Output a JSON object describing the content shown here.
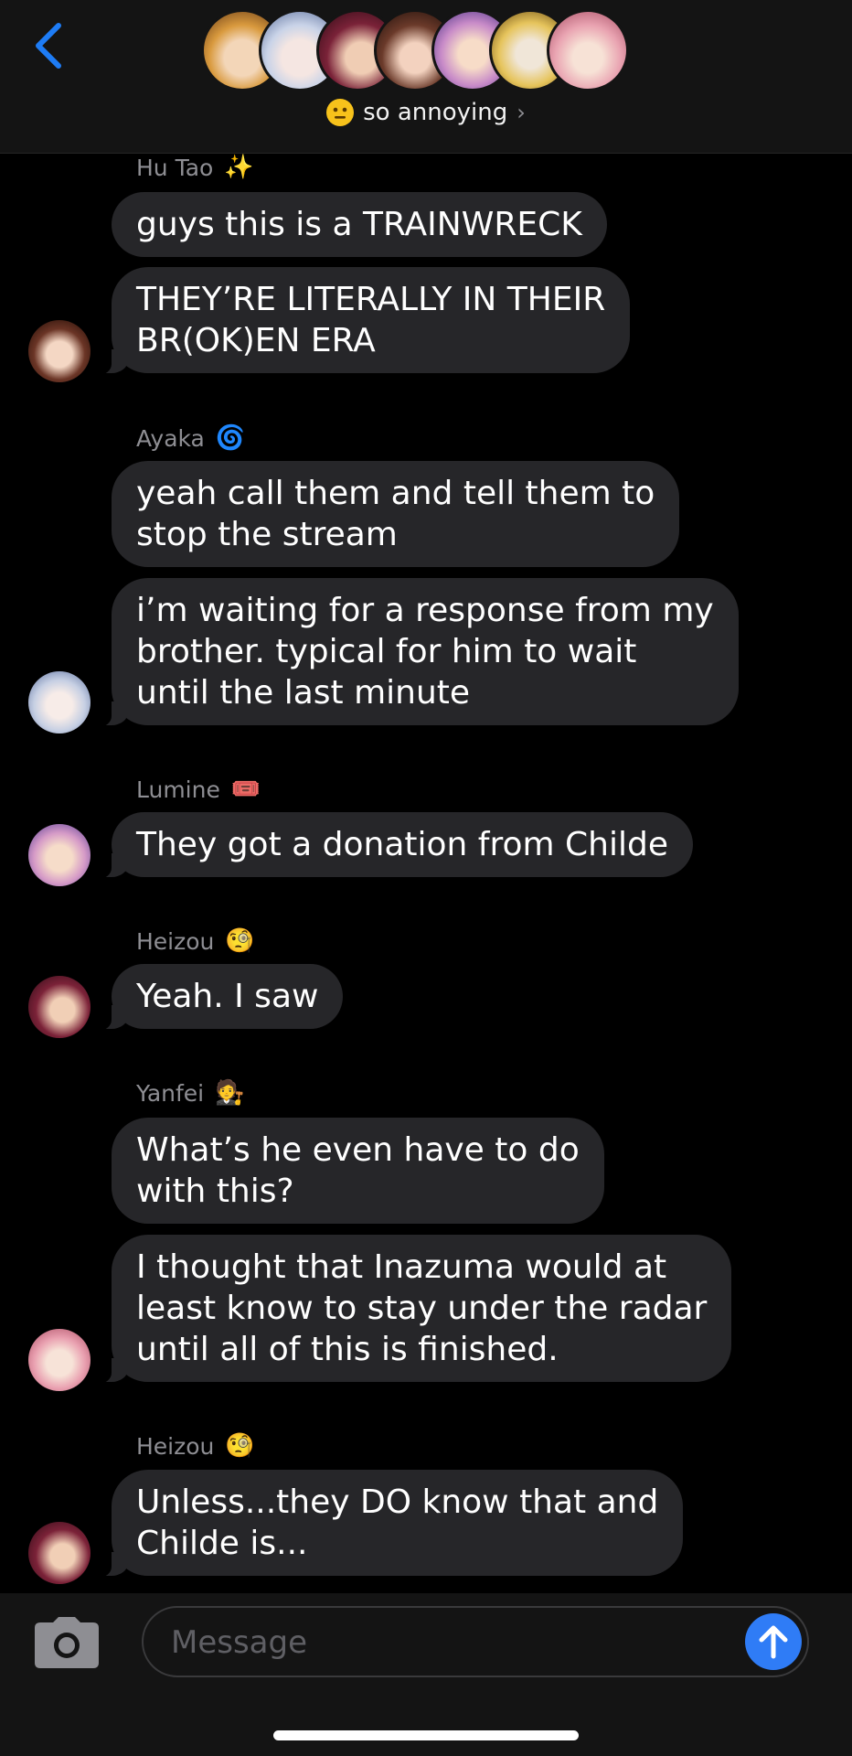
{
  "header": {
    "group_name": "so annoying",
    "chevron": "›",
    "group_emoji": "neutral-face-emoji",
    "avatars": [
      "yanfei-avatar",
      "ayaka-avatar",
      "heizou-avatar",
      "hu-tao-avatar",
      "lumine-avatar",
      "glasses-plush-avatar",
      "yanfei-pink-avatar"
    ]
  },
  "messages": [
    {
      "sender": "Hu Tao",
      "emoji": "✨",
      "bubbles": [
        "guys this is a TRAINWRECK",
        "THEY’RE LITERALLY IN THEIR\nBR(OK)EN ERA"
      ]
    },
    {
      "sender": "Ayaka",
      "emoji": "🌀",
      "bubbles": [
        "yeah call them and tell them to\nstop the stream",
        "i’m waiting for a response from my\nbrother. typical for him to wait\nuntil the last minute"
      ]
    },
    {
      "sender": "Lumine",
      "emoji": "🎟️",
      "bubbles": [
        "They got a donation from Childe"
      ]
    },
    {
      "sender": "Heizou",
      "emoji": "🧐",
      "bubbles": [
        "Yeah. I saw"
      ]
    },
    {
      "sender": "Yanfei",
      "emoji": "🧑‍⚖️",
      "bubbles": [
        "What’s he even have to do\nwith this?",
        "I thought that Inazuma would at\nleast know to stay under the radar\nuntil all of this is finished."
      ]
    },
    {
      "sender": "Heizou",
      "emoji": "🧐",
      "bubbles": [
        "Unless...they DO know that and\nChilde is..."
      ]
    }
  ],
  "composer": {
    "placeholder": "Message"
  },
  "colors": {
    "bubble": "#262629",
    "accent": "#2f7cf6",
    "back_arrow": "#1e7cf5",
    "sender": "#8e8e93"
  }
}
